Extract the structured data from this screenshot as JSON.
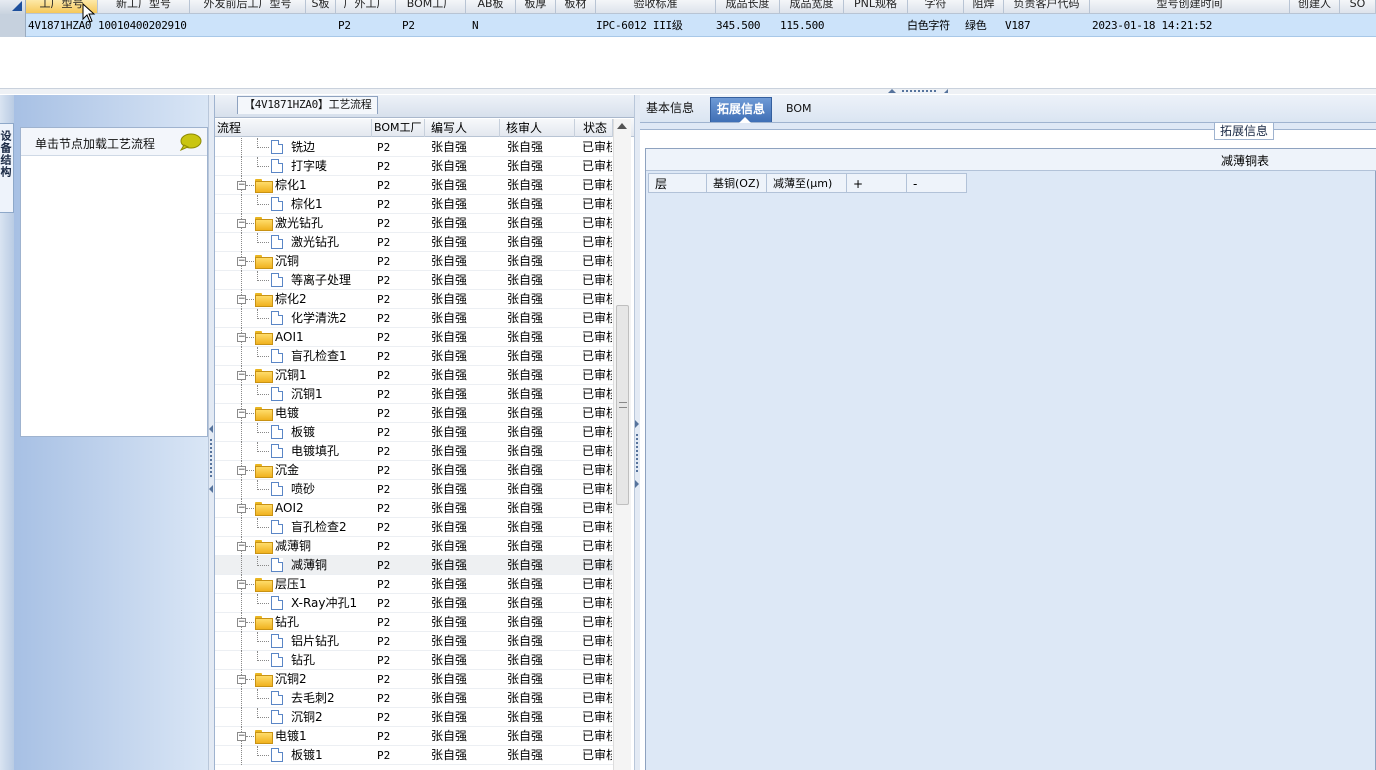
{
  "top_grid": {
    "headers": [
      "工厂型号",
      "新工厂型号",
      "外发前后工厂型号",
      "S板",
      "厂外工厂",
      "BOM工厂",
      "AB板",
      "板厚",
      "板材",
      "验收标准",
      "成品长度",
      "成品宽度",
      "PNL规格",
      "字符",
      "阻焊",
      "负责客户代码",
      "型号创建时间",
      "创建人",
      "SO"
    ],
    "row": {
      "model": "4V1871HZA0",
      "new_model": "10010400202910",
      "factory": "P2",
      "bom_factory": "P2",
      "ab_board": "N",
      "standard": "IPC-6012 III级",
      "length": "345.500",
      "width": "115.500",
      "silkscreen": "白色字符",
      "solder_mask": "绿色",
      "customer_code": "V187",
      "created_time": "2023-01-18 14:21:52"
    }
  },
  "left_panel": {
    "rail_tab": "设备结构",
    "hint": "单击节点加载工艺流程"
  },
  "mid_panel": {
    "title": "【4V1871HZA0】工艺流程",
    "columns": [
      "流程",
      "BOM工厂",
      "编写人",
      "核审人",
      "状态"
    ],
    "rows": [
      {
        "name": "铣边",
        "type": "doc",
        "factory": "P2",
        "writer": "张自强",
        "reviewer": "张自强",
        "status": "已审核"
      },
      {
        "name": "打字唛",
        "type": "doc",
        "factory": "P2",
        "writer": "张自强",
        "reviewer": "张自强",
        "status": "已审核"
      },
      {
        "name": "棕化1",
        "type": "folder",
        "factory": "P2",
        "writer": "张自强",
        "reviewer": "张自强",
        "status": "已审核"
      },
      {
        "name": "棕化1",
        "type": "doc",
        "factory": "P2",
        "writer": "张自强",
        "reviewer": "张自强",
        "status": "已审核"
      },
      {
        "name": "激光钻孔",
        "type": "folder",
        "factory": "P2",
        "writer": "张自强",
        "reviewer": "张自强",
        "status": "已审核"
      },
      {
        "name": "激光钻孔",
        "type": "doc",
        "factory": "P2",
        "writer": "张自强",
        "reviewer": "张自强",
        "status": "已审核"
      },
      {
        "name": "沉铜",
        "type": "folder",
        "factory": "P2",
        "writer": "张自强",
        "reviewer": "张自强",
        "status": "已审核"
      },
      {
        "name": "等离子处理",
        "type": "doc",
        "factory": "P2",
        "writer": "张自强",
        "reviewer": "张自强",
        "status": "已审核"
      },
      {
        "name": "棕化2",
        "type": "folder",
        "factory": "P2",
        "writer": "张自强",
        "reviewer": "张自强",
        "status": "已审核"
      },
      {
        "name": "化学清洗2",
        "type": "doc",
        "factory": "P2",
        "writer": "张自强",
        "reviewer": "张自强",
        "status": "已审核"
      },
      {
        "name": "AOI1",
        "type": "folder",
        "factory": "P2",
        "writer": "张自强",
        "reviewer": "张自强",
        "status": "已审核"
      },
      {
        "name": "盲孔检查1",
        "type": "doc",
        "factory": "P2",
        "writer": "张自强",
        "reviewer": "张自强",
        "status": "已审核"
      },
      {
        "name": "沉铜1",
        "type": "folder",
        "factory": "P2",
        "writer": "张自强",
        "reviewer": "张自强",
        "status": "已审核"
      },
      {
        "name": "沉铜1",
        "type": "doc",
        "factory": "P2",
        "writer": "张自强",
        "reviewer": "张自强",
        "status": "已审核"
      },
      {
        "name": "电镀",
        "type": "folder",
        "factory": "P2",
        "writer": "张自强",
        "reviewer": "张自强",
        "status": "已审核"
      },
      {
        "name": "板镀",
        "type": "doc",
        "factory": "P2",
        "writer": "张自强",
        "reviewer": "张自强",
        "status": "已审核"
      },
      {
        "name": "电镀填孔",
        "type": "doc",
        "factory": "P2",
        "writer": "张自强",
        "reviewer": "张自强",
        "status": "已审核"
      },
      {
        "name": "沉金",
        "type": "folder",
        "factory": "P2",
        "writer": "张自强",
        "reviewer": "张自强",
        "status": "已审核"
      },
      {
        "name": "喷砂",
        "type": "doc",
        "factory": "P2",
        "writer": "张自强",
        "reviewer": "张自强",
        "status": "已审核"
      },
      {
        "name": "AOI2",
        "type": "folder",
        "factory": "P2",
        "writer": "张自强",
        "reviewer": "张自强",
        "status": "已审核"
      },
      {
        "name": "盲孔检查2",
        "type": "doc",
        "factory": "P2",
        "writer": "张自强",
        "reviewer": "张自强",
        "status": "已审核"
      },
      {
        "name": "减薄铜",
        "type": "folder",
        "factory": "P2",
        "writer": "张自强",
        "reviewer": "张自强",
        "status": "已审核"
      },
      {
        "name": "减薄铜",
        "type": "doc",
        "factory": "P2",
        "writer": "张自强",
        "reviewer": "张自强",
        "status": "已审核",
        "selected": true
      },
      {
        "name": "层压1",
        "type": "folder",
        "factory": "P2",
        "writer": "张自强",
        "reviewer": "张自强",
        "status": "已审核"
      },
      {
        "name": "X-Ray冲孔1",
        "type": "doc",
        "factory": "P2",
        "writer": "张自强",
        "reviewer": "张自强",
        "status": "已审核"
      },
      {
        "name": "钻孔",
        "type": "folder",
        "factory": "P2",
        "writer": "张自强",
        "reviewer": "张自强",
        "status": "已审核"
      },
      {
        "name": "铝片钻孔",
        "type": "doc",
        "factory": "P2",
        "writer": "张自强",
        "reviewer": "张自强",
        "status": "已审核"
      },
      {
        "name": "钻孔",
        "type": "doc",
        "factory": "P2",
        "writer": "张自强",
        "reviewer": "张自强",
        "status": "已审核"
      },
      {
        "name": "沉铜2",
        "type": "folder",
        "factory": "P2",
        "writer": "张自强",
        "reviewer": "张自强",
        "status": "已审核"
      },
      {
        "name": "去毛刺2",
        "type": "doc",
        "factory": "P2",
        "writer": "张自强",
        "reviewer": "张自强",
        "status": "已审核"
      },
      {
        "name": "沉铜2",
        "type": "doc",
        "factory": "P2",
        "writer": "张自强",
        "reviewer": "张自强",
        "status": "已审核"
      },
      {
        "name": "电镀1",
        "type": "folder",
        "factory": "P2",
        "writer": "张自强",
        "reviewer": "张自强",
        "status": "已审核"
      },
      {
        "name": "板镀1",
        "type": "doc",
        "factory": "P2",
        "writer": "张自强",
        "reviewer": "张自强",
        "status": "已审核"
      }
    ]
  },
  "right_panel": {
    "tabs": [
      "基本信息",
      "拓展信息",
      "BOM"
    ],
    "active_tab": "拓展信息",
    "group_title": "拓展信息",
    "table_title": "减薄铜表",
    "columns": [
      "层",
      "基铜(OZ)",
      "减薄至(μm)",
      "+",
      "-"
    ]
  },
  "colors": {
    "selected_row": "#cce3fa",
    "active_tab": "#3f6fb5",
    "panel_bg": "#dfe8f5",
    "folder": "#f0b21e"
  }
}
